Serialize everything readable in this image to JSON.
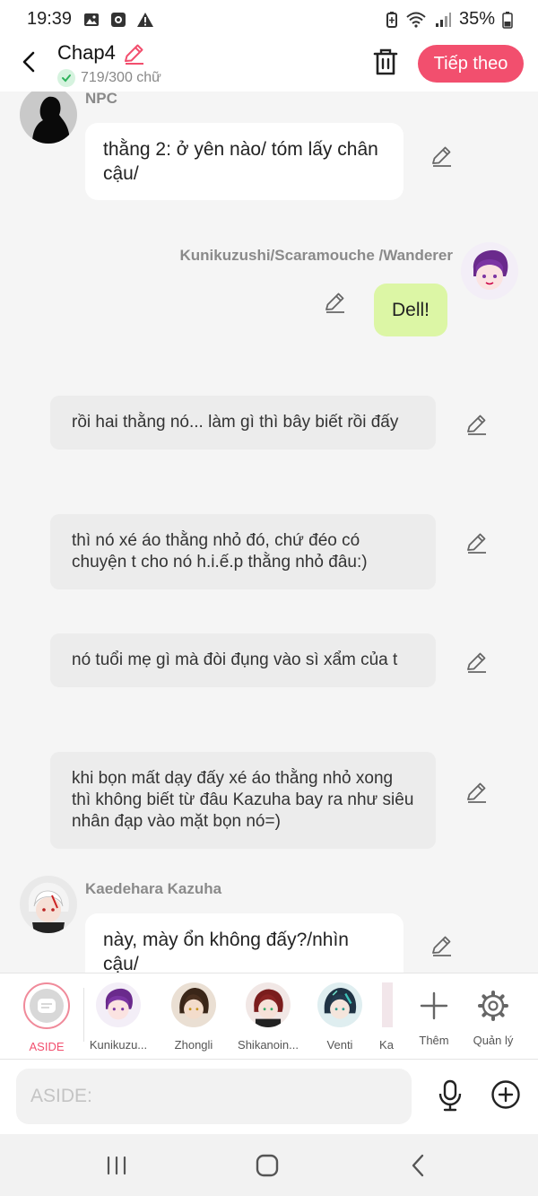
{
  "status_bar": {
    "time": "19:39",
    "battery": "35%",
    "left_icons": [
      "image-icon",
      "screen-record-icon",
      "warning-icon"
    ],
    "right_icons": [
      "battery-saver-icon",
      "wifi-icon",
      "signal-icon",
      "battery-icon"
    ]
  },
  "header": {
    "title": "Chap4",
    "word_count": "719/300 chữ",
    "next_label": "Tiếp theo",
    "accent_color": "#f24f6e"
  },
  "messages": [
    {
      "speaker": "NPC",
      "text": "thằng 2: ở yên nào/ tóm lấy chân cậu/"
    },
    {
      "speaker": "Kunikuzushi/Scaramouche /Wanderer",
      "text": "Dell!"
    },
    {
      "text": "rồi hai thằng nó... làm gì thì bây biết rồi đấy"
    },
    {
      "text": "thì nó xé áo thằng nhỏ đó, chứ đéo có chuyện t cho nó h.i.ế.p thằng nhỏ đâu:)"
    },
    {
      "text": "nó tuổi mẹ gì mà đòi đụng vào sì xẩm của t"
    },
    {
      "text": "khi bọn mất dạy đấy xé áo thằng nhỏ xong thì không biết từ đâu Kazuha bay ra như siêu nhân đạp vào mặt bọn nó=)"
    },
    {
      "speaker": "Kaedehara Kazuha",
      "text": "này, mày ổn không đấy?/nhìn cậu/"
    }
  ],
  "character_bar": {
    "aside_label": "ASIDE",
    "characters": [
      "Kunikuzu...",
      "Zhongli",
      "Shikanoin...",
      "Venti",
      "Ka"
    ],
    "more_label": "Thêm",
    "manage_label": "Quản lý"
  },
  "input": {
    "placeholder": "ASIDE:"
  }
}
